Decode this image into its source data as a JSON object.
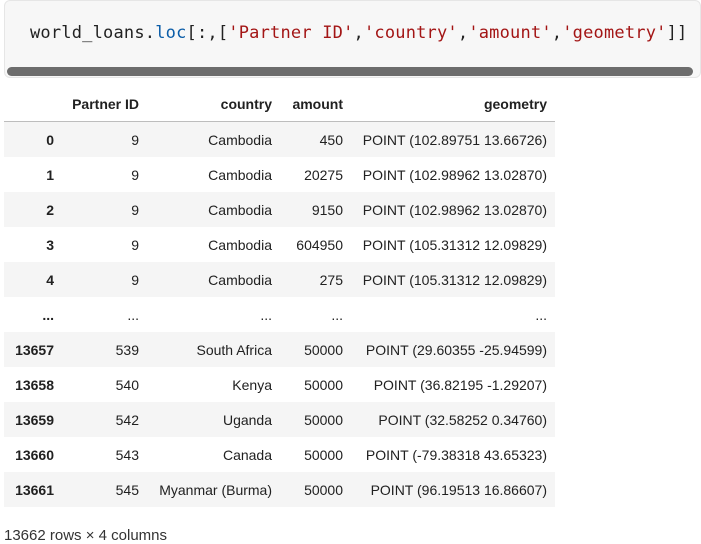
{
  "code": {
    "object": "world_loans",
    "dot": ".",
    "attr": "loc",
    "open": "[:,[",
    "cols": [
      "'Partner ID'",
      "'country'",
      "'amount'",
      "'geometry'"
    ],
    "sep": ",",
    "close": "]]"
  },
  "table": {
    "headers": [
      "",
      "Partner ID",
      "country",
      "amount",
      "geometry"
    ],
    "rows": [
      {
        "index": "0",
        "partner_id": "9",
        "country": "Cambodia",
        "amount": "450",
        "geometry": "POINT (102.89751 13.66726)"
      },
      {
        "index": "1",
        "partner_id": "9",
        "country": "Cambodia",
        "amount": "20275",
        "geometry": "POINT (102.98962 13.02870)"
      },
      {
        "index": "2",
        "partner_id": "9",
        "country": "Cambodia",
        "amount": "9150",
        "geometry": "POINT (102.98962 13.02870)"
      },
      {
        "index": "3",
        "partner_id": "9",
        "country": "Cambodia",
        "amount": "604950",
        "geometry": "POINT (105.31312 12.09829)"
      },
      {
        "index": "4",
        "partner_id": "9",
        "country": "Cambodia",
        "amount": "275",
        "geometry": "POINT (105.31312 12.09829)"
      },
      {
        "index": "...",
        "partner_id": "...",
        "country": "...",
        "amount": "...",
        "geometry": "..."
      },
      {
        "index": "13657",
        "partner_id": "539",
        "country": "South Africa",
        "amount": "50000",
        "geometry": "POINT (29.60355 -25.94599)"
      },
      {
        "index": "13658",
        "partner_id": "540",
        "country": "Kenya",
        "amount": "50000",
        "geometry": "POINT (36.82195 -1.29207)"
      },
      {
        "index": "13659",
        "partner_id": "542",
        "country": "Uganda",
        "amount": "50000",
        "geometry": "POINT (32.58252 0.34760)"
      },
      {
        "index": "13660",
        "partner_id": "543",
        "country": "Canada",
        "amount": "50000",
        "geometry": "POINT (-79.38318 43.65323)"
      },
      {
        "index": "13661",
        "partner_id": "545",
        "country": "Myanmar (Burma)",
        "amount": "50000",
        "geometry": "POINT (96.19513 16.86607)"
      }
    ]
  },
  "footer": {
    "shape_text": "13662 rows × 4 columns"
  },
  "colors": {
    "code_bg": "#f7f7f7",
    "string": "#a31515",
    "attribute": "#0b5da8",
    "stripe": "#f5f5f5"
  }
}
